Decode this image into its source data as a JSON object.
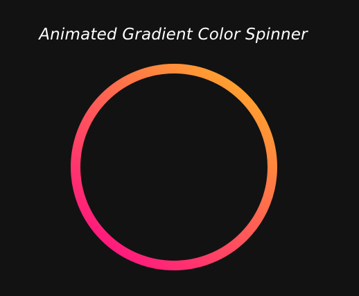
{
  "page": {
    "title": "Animated Gradient Color Spinner",
    "background_color": "#121212",
    "title_color": "#ffffff"
  },
  "spinner": {
    "gradient_start_color": "#ff1a7d",
    "gradient_end_color": "#ffa32e"
  }
}
